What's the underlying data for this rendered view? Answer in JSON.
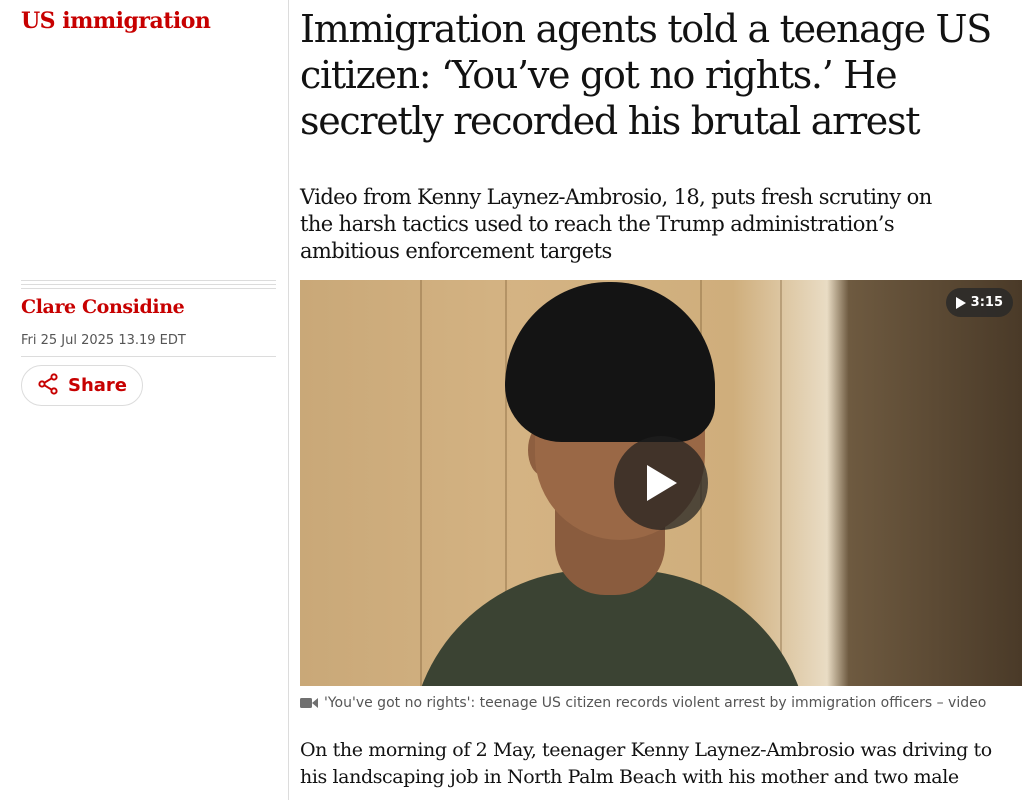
{
  "section": {
    "label": "US immigration"
  },
  "article": {
    "headline": "Immigration agents told a teenage US citizen: ‘You’ve got no rights.’ He secretly recorded his brutal arrest",
    "standfirst": "Video from Kenny Laynez-Ambrosio, 18, puts fresh scrutiny on the harsh tactics used to reach the Trump administration’s ambitious enforcement targets",
    "body_first": "On the morning of 2 May, teenager Kenny Laynez-Ambrosio was driving to his landscaping job in North Palm Beach with his mother and two male"
  },
  "meta": {
    "author": "Clare Considine",
    "date": "Fri 25 Jul 2025 13.19 EDT",
    "share_label": "Share"
  },
  "video": {
    "duration": "3:15",
    "caption": "'You've got no rights': teenage US citizen records violent arrest by immigration officers – video"
  },
  "colors": {
    "accent": "#c70000",
    "text": "#121212",
    "muted": "#555555"
  },
  "icons": {
    "share": "share-icon",
    "play": "play-icon",
    "video": "video-camera-icon"
  }
}
